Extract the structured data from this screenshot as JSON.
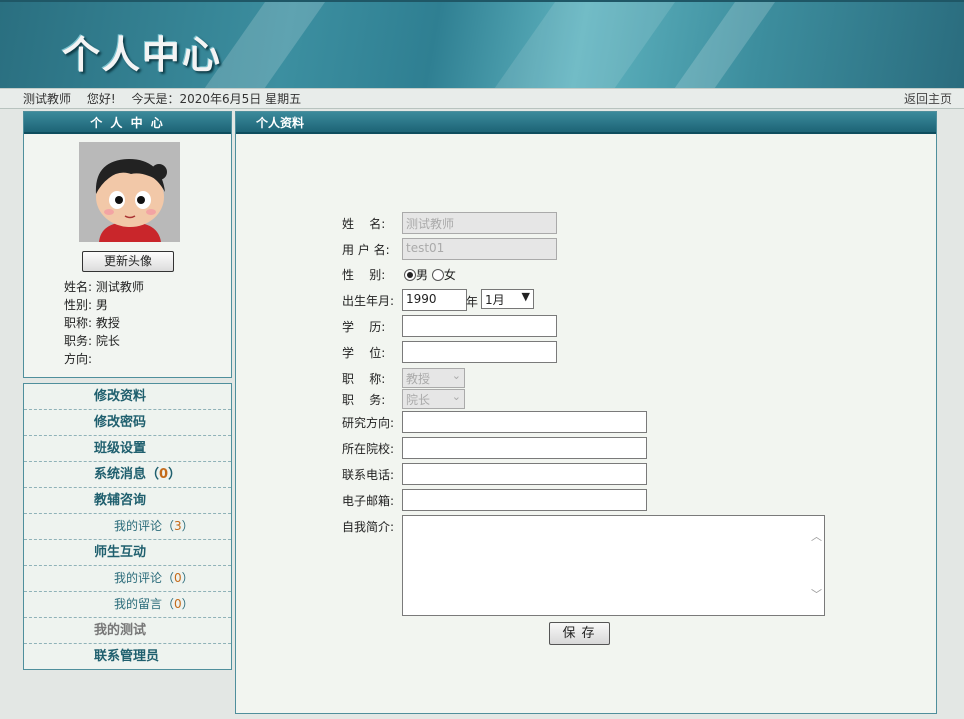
{
  "banner": {
    "title": "个人中心"
  },
  "infobar": {
    "user": "测试教师",
    "greeting": "您好!",
    "date": "今天是：2020年6月5日 星期五",
    "home_link": "返回主页"
  },
  "profile": {
    "header": "个 人 中 心",
    "update_avatar": "更新头像",
    "fields": [
      "姓名: 测试教师",
      "性别: 男",
      "职称: 教授",
      "职务: 院长",
      "方向:"
    ]
  },
  "menu": [
    {
      "label": "修改资料",
      "count": ""
    },
    {
      "label": "修改密码",
      "count": ""
    },
    {
      "label": "班级设置",
      "count": ""
    },
    {
      "label": "系统消息",
      "count": "0"
    },
    {
      "label": "教辅咨询",
      "count": ""
    },
    {
      "label": "我的评论",
      "count": "3"
    },
    {
      "label": "师生互动",
      "count": ""
    },
    {
      "label": "我的评论",
      "count": "0"
    },
    {
      "label": "我的留言",
      "count": "0"
    },
    {
      "label": "我的测试",
      "count": ""
    },
    {
      "label": "联系管理员",
      "count": ""
    }
  ],
  "form": {
    "header": "个人资料",
    "name_label": "姓    名:",
    "name_value": "测试教师",
    "username_label": "用 户 名:",
    "username_value": "test01",
    "gender_label": "性    别:",
    "gender_male": "男",
    "gender_female": "女",
    "birth_label": "出生年月:",
    "birth_year": "1990",
    "year_unit": "年",
    "birth_month": "1月",
    "education_label": "学    历:",
    "degree_label": "学    位:",
    "title_label": "职    称:",
    "title_value": "教授",
    "position_label": "职    务:",
    "position_value": "院长",
    "research_label": "研究方向:",
    "school_label": "所在院校:",
    "phone_label": "联系电话:",
    "email_label": "电子邮箱:",
    "intro_label": "自我简介:",
    "save_label": "保存"
  },
  "colors": {
    "header_teal": "#1d6476",
    "accent_orange": "#c46a1a",
    "link_teal": "#1f5f6e"
  }
}
